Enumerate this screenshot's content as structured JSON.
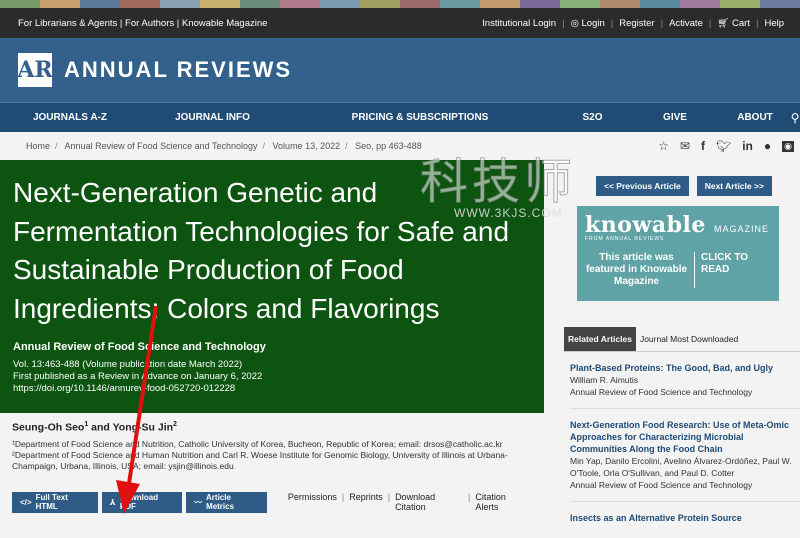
{
  "top": {
    "links": "For Librarians & Agents | For Authors | Knowable Magazine",
    "right": [
      "Institutional Login",
      "Login",
      "Register",
      "Activate",
      "Cart",
      "Help"
    ]
  },
  "brand": {
    "logo_letters": "AR",
    "name": "ANNUAL REVIEWS"
  },
  "nav": [
    "JOURNALS A-Z",
    "JOURNAL INFO",
    "PRICING & SUBSCRIPTIONS",
    "S2O",
    "GIVE",
    "ABOUT"
  ],
  "breadcrumb": [
    "Home",
    "Annual Review of Food Science and Technology",
    "Volume 13, 2022",
    "Seo, pp 463-488"
  ],
  "article": {
    "title": "Next-Generation Genetic and Fermentation Technologies for Safe and Sustainable Production of Food Ingredients: Colors and Flavorings",
    "journal": "Annual Review of Food Science and Technology",
    "vol": "Vol. 13:463-488 (Volume publication date March 2022)",
    "first_published": "First published as a Review in Advance on January 6, 2022",
    "doi": "https://doi.org/10.1146/annurev-food-052720-012228",
    "author1": "Seung-Oh Seo",
    "author2": "Yong-Su Jin",
    "aff1": "¹Department of Food Science and Nutrition, Catholic University of Korea, Bucheon, Republic of Korea; email: drsos@catholic.ac.kr",
    "aff2": "²Department of Food Science and Human Nutrition and Carl R. Woese Institute for Genomic Biology, University of Illinois at Urbana-Champaign, Urbana, Illinois, USA; email: ysjin@illinois.edu"
  },
  "actions": {
    "full_text": "Full Text HTML",
    "pdf": "Download PDF",
    "metrics": "Article Metrics",
    "links": [
      "Permissions",
      "Reprints",
      "Download Citation",
      "Citation Alerts"
    ]
  },
  "pager": {
    "prev": "<< Previous Article",
    "next": "Next Article >>"
  },
  "knowable": {
    "brand": "knowable",
    "magazine": "MAGAZINE",
    "from": "FROM ANNUAL REVIEWS",
    "cta_left": "This article was featured in Knowable Magazine",
    "cta_right": "CLICK TO READ"
  },
  "tabs": [
    "Related Articles",
    "Journal Most Downloaded"
  ],
  "related": [
    {
      "title": "Plant-Based Proteins: The Good, Bad, and Ugly",
      "authors": "William R. Aimutis",
      "journal": "Annual Review of Food Science and Technology"
    },
    {
      "title": "Next-Generation Food Research: Use of Meta-Omic Approaches for Characterizing Microbial Communities Along the Food Chain",
      "authors": "Min Yap, Danilo Ercolini, Avelino Álvarez-Ordóñez, Paul W. O'Toole, Orla O'Sullivan, and Paul D. Cotter",
      "journal": "Annual Review of Food Science and Technology"
    },
    {
      "title": "Insects as an Alternative Protein Source",
      "authors": "",
      "journal": ""
    }
  ],
  "watermark": {
    "text": "科技师",
    "url": "WWW.3KJS.COM"
  },
  "colors": {
    "header": "#34618b",
    "nav": "#1f4b75",
    "hero": "#0d5410",
    "button": "#2e5c87",
    "knowable": "#5fa3a6"
  }
}
